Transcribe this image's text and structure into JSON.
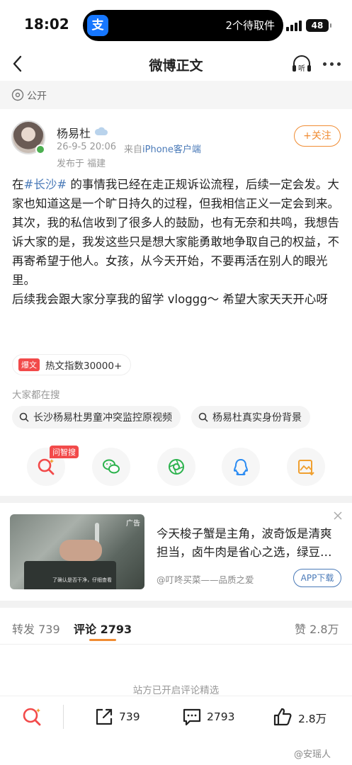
{
  "status_bar": {
    "time": "18:02",
    "island_text": "2个待取件",
    "app_icon_char": "支",
    "battery": "48"
  },
  "nav": {
    "title": "微博正文",
    "listen_label": "听"
  },
  "visibility": {
    "label": "公开"
  },
  "author": {
    "name": "杨易杜",
    "time": "26-9-5 20:06",
    "source_prefix": "来自",
    "source_client": "iPhone客户端",
    "location": "发布于 福建",
    "follow_label": "+关注"
  },
  "post": {
    "p1_prefix": "在",
    "p1_tag": "#长沙#",
    "p1_rest": " 的事情我已经在走正规诉讼流程，后续一定会发。大家也知道这是一个旷日持久的过程，但我相信正义一定会到来。",
    "p2": "其次，我的私信收到了很多人的鼓励，也有无奈和共鸣，我想告诉大家的是，我发这些只是想大家能勇敢地争取自己的权益，不再寄希望于他人。女孩，从今天开始，不要再活在别人的眼光里。",
    "p3": "后续我会跟大家分享我的留学 vloggg～ 希望大家天天开心呀"
  },
  "hot": {
    "badge": "爆文",
    "text": "热文指数30000+"
  },
  "search": {
    "title": "大家都在搜",
    "items": [
      "长沙杨易杜男童冲突监控原视频",
      "杨易杜真实身份背景"
    ]
  },
  "share": {
    "ask_badge": "问智搜",
    "icons": [
      "ask-search-icon",
      "wechat-icon",
      "moments-icon",
      "qq-icon",
      "save-image-icon"
    ]
  },
  "ad": {
    "tag": "广告",
    "caption": "了确认是否干净，仔细查看",
    "title": "今天梭子蟹是主角，波奇饭是清爽担当，卤牛肉是省心之选，绿豆…",
    "sponsor": "@叮咚买菜——品质之爱",
    "button": "APP下载"
  },
  "tabs": {
    "repost": "转发 739",
    "comments": "评论 2793",
    "likes": "赞 2.8万"
  },
  "comments_note": "站方已开启评论精选",
  "bottom_bar": {
    "repost_count": "739",
    "comment_count": "2793",
    "like_count": "2.8万"
  },
  "watermark": "@安瑶人",
  "colors": {
    "accent_orange": "#f08c33",
    "link_blue": "#4a7ab8",
    "hot_red": "#f24a4a"
  }
}
